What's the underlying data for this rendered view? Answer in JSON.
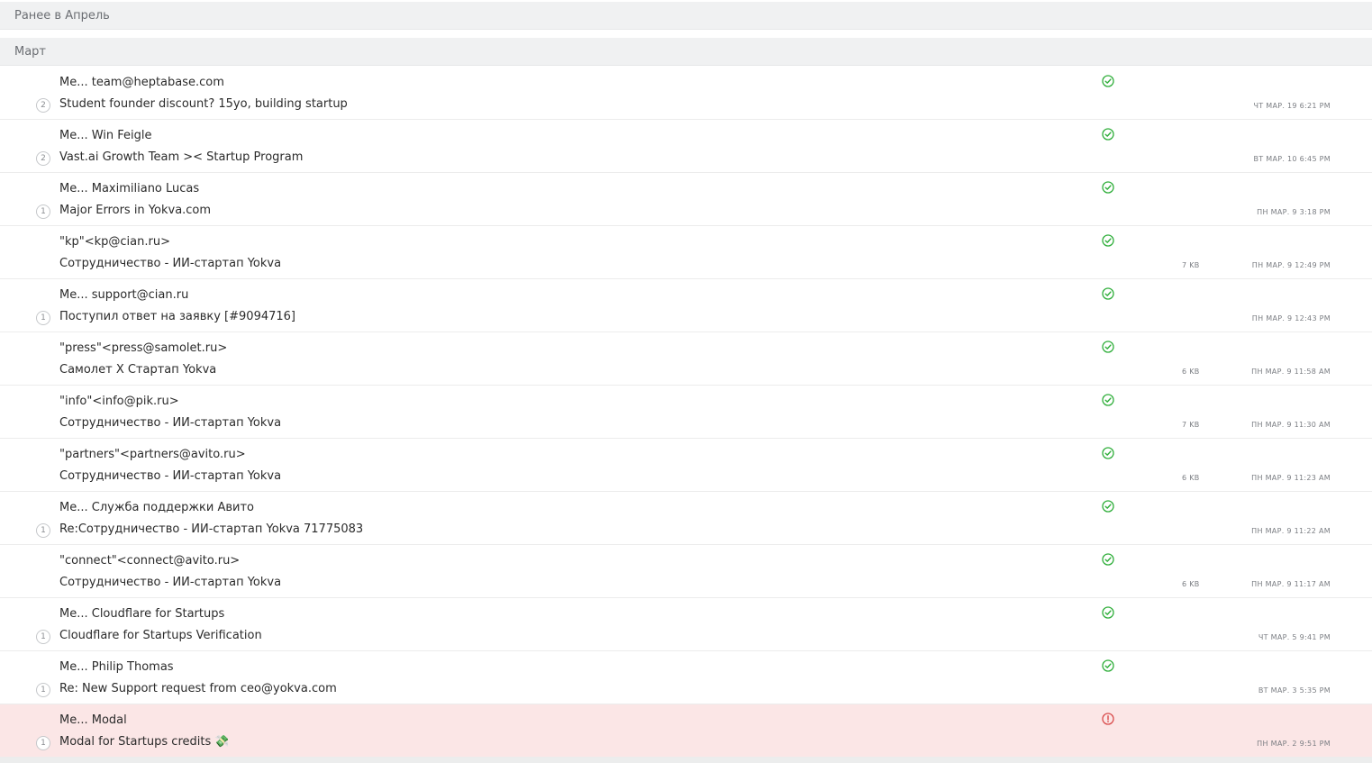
{
  "groups": {
    "earlier": "Ранее в Апрель",
    "march": "Март"
  },
  "colors": {
    "ok": "#2fae3a",
    "error": "#d94a4a",
    "warn_row": "#fbe6e6"
  },
  "messages": [
    {
      "from": "Me... team@heptabase.com",
      "subject": "Student founder discount? 15yo, building startup",
      "count": "2",
      "size": "",
      "date": "ЧТ МАР. 19 6:21 PM",
      "status": "check-circle-icon"
    },
    {
      "from": "Me... Win Feigle",
      "subject": "Vast.ai Growth Team >< Startup Program",
      "count": "2",
      "size": "",
      "date": "ВТ МАР. 10 6:45 PM",
      "status": "check-circle-icon"
    },
    {
      "from": "Me... Maximiliano Lucas",
      "subject": "Major Errors in Yokva.com",
      "count": "1",
      "size": "",
      "date": "ПН МАР. 9 3:18 PM",
      "status": "check-circle-icon"
    },
    {
      "from": "\"kp\"<kp@cian.ru>",
      "subject": "Сотрудничество - ИИ-стартап Yokva",
      "count": "",
      "size": "7 KB",
      "date": "ПН МАР. 9 12:49 PM",
      "status": "check-circle-icon"
    },
    {
      "from": "Me... support@cian.ru",
      "subject": "Поступил ответ на заявку [#9094716]",
      "count": "1",
      "size": "",
      "date": "ПН МАР. 9 12:43 PM",
      "status": "check-circle-icon"
    },
    {
      "from": "\"press\"<press@samolet.ru>",
      "subject": "Самолет X Стартап Yokva",
      "count": "",
      "size": "6 KB",
      "date": "ПН МАР. 9 11:58 AM",
      "status": "check-circle-icon"
    },
    {
      "from": "\"info\"<info@pik.ru>",
      "subject": "Сотрудничество - ИИ-стартап Yokva",
      "count": "",
      "size": "7 KB",
      "date": "ПН МАР. 9 11:30 AM",
      "status": "check-circle-icon"
    },
    {
      "from": "\"partners\"<partners@avito.ru>",
      "subject": "Сотрудничество - ИИ-стартап Yokva",
      "count": "",
      "size": "6 KB",
      "date": "ПН МАР. 9 11:23 AM",
      "status": "check-circle-icon"
    },
    {
      "from": "Me... Служба поддержки Авито",
      "subject": "Re:Сотрудничество - ИИ-стартап Yokva 71775083",
      "count": "1",
      "size": "",
      "date": "ПН МАР. 9 11:22 AM",
      "status": "check-circle-icon"
    },
    {
      "from": "\"connect\"<connect@avito.ru>",
      "subject": "Сотрудничество - ИИ-стартап Yokva",
      "count": "",
      "size": "6 KB",
      "date": "ПН МАР. 9 11:17 AM",
      "status": "check-circle-icon"
    },
    {
      "from": "Me... Cloudflare for Startups",
      "subject": "Cloudflare for Startups Verification",
      "count": "1",
      "size": "",
      "date": "ЧТ МАР. 5 9:41 PM",
      "status": "check-circle-icon"
    },
    {
      "from": "Me... Philip Thomas",
      "subject": "Re: New Support request from ceo@yokva.com",
      "count": "1",
      "size": "",
      "date": "ВТ МАР. 3 5:35 PM",
      "status": "check-circle-icon"
    },
    {
      "from": "Me... Modal",
      "subject": "Modal for Startups credits 💸",
      "count": "1",
      "size": "",
      "date": "ПН МАР. 2 9:51 PM",
      "status": "alert-circle-icon"
    }
  ]
}
